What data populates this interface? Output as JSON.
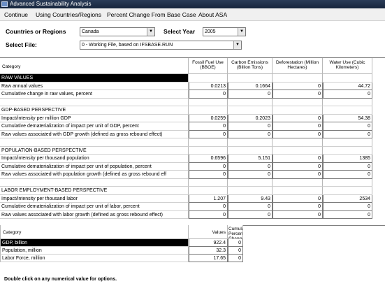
{
  "window": {
    "title": "Advanced Sustainability Analysis"
  },
  "menu": {
    "items": [
      {
        "label": "Continue"
      },
      {
        "label": "Using Countries/Regions"
      },
      {
        "label": "Percent Change From Base Case"
      },
      {
        "label": "About ASA"
      }
    ]
  },
  "controls": {
    "countries_label": "Countries or Regions",
    "countries_value": "Canada",
    "year_label": "Select Year",
    "year_value": "2005",
    "file_label": "Select File:",
    "file_value": "0 - Working File, based on IFSBASE.RUN"
  },
  "grid": {
    "columns": {
      "category": "Category",
      "fossil": "Fossil Fuel Use (BBOE)",
      "carbon": "Carbon Emissions (Billion Tons)",
      "deforest": "Deforestation (Million Hectares)",
      "water": "Water Use (Cubic Kilometers)"
    },
    "rows": [
      {
        "label": "RAW VALUES",
        "kind": "section-selected"
      },
      {
        "label": "Raw annual values",
        "v": [
          "0.0213",
          "0.1664",
          "0",
          "44.72"
        ]
      },
      {
        "label": "Cumulative change in raw values, percent",
        "v": [
          "0",
          "0",
          "0",
          "0"
        ]
      },
      {
        "label": "",
        "kind": "blank"
      },
      {
        "label": "GDP-BASED PERSPECTIVE",
        "kind": "section"
      },
      {
        "label": "Impact/intensity per million GDP",
        "v": [
          "0.0259",
          "0.2023",
          "0",
          "54.38"
        ]
      },
      {
        "label": "Cumulative dematerialization of impact per unit of GDP, percent",
        "v": [
          "0",
          "0",
          "0",
          "0"
        ]
      },
      {
        "label": "Raw values associated with GDP growth (defined as gross rebound effect)",
        "v": [
          "0",
          "0",
          "0",
          "0"
        ]
      },
      {
        "label": "",
        "kind": "blank"
      },
      {
        "label": "POPULATION-BASED PERSPECTIVE",
        "kind": "section"
      },
      {
        "label": "Impact/intensity per thousand population",
        "v": [
          "0.6596",
          "5.151",
          "0",
          "1385"
        ]
      },
      {
        "label": "Cumulative dematerialization of impact per unit of population, percent",
        "v": [
          "0",
          "0",
          "0",
          "0"
        ]
      },
      {
        "label": "Raw values associated with population growth (defined as gross rebound eff",
        "v": [
          "0",
          "0",
          "0",
          "0"
        ]
      },
      {
        "label": "",
        "kind": "blank"
      },
      {
        "label": "LABOR EMPLOYMENT-BASED PERSPECTIVE",
        "kind": "section"
      },
      {
        "label": "Impact/intensity per thousand labor",
        "v": [
          "1.207",
          "9.43",
          "0",
          "2534"
        ]
      },
      {
        "label": "Cumulative dematerialization of impact per unit of labor, percent",
        "v": [
          "0",
          "0",
          "0",
          "0"
        ]
      },
      {
        "label": "Raw values associated with labor growth (defined as gross rebound effect)",
        "v": [
          "0",
          "0",
          "0",
          "0"
        ]
      }
    ]
  },
  "grid2": {
    "columns": {
      "category": "Category",
      "values": "Values",
      "pct": "Cumulative Percentage Change"
    },
    "rows": [
      {
        "label": "GDP, billion",
        "value": "922.4",
        "pct": "0",
        "selected": true
      },
      {
        "label": "Population, million",
        "value": "32.3",
        "pct": "0"
      },
      {
        "label": "Labor Force, million",
        "value": "17.65",
        "pct": "0"
      }
    ]
  },
  "footer": {
    "note": "Double click on any numerical value for options."
  }
}
